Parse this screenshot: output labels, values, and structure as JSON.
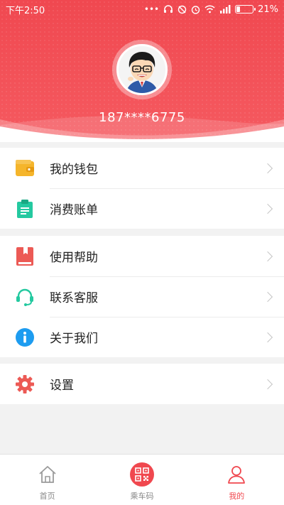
{
  "status": {
    "time": "下午2:50",
    "battery": "21%",
    "battery_level": 0.21,
    "icons": [
      "more-dots-icon",
      "headphones-icon",
      "no-notify-icon",
      "alarm-icon",
      "wifi-icon",
      "signal-icon",
      "battery-icon"
    ]
  },
  "profile": {
    "phone": "187****6775"
  },
  "menu_group1": [
    {
      "label": "我的钱包",
      "icon": "wallet-icon",
      "color": "#f5b52b"
    },
    {
      "label": "消费账单",
      "icon": "clipboard-icon",
      "color": "#24c9a0"
    }
  ],
  "menu_group2": [
    {
      "label": "使用帮助",
      "icon": "book-icon",
      "color": "#ec5a55"
    },
    {
      "label": "联系客服",
      "icon": "headset-icon",
      "color": "#24c9a0"
    },
    {
      "label": "关于我们",
      "icon": "info-icon",
      "color": "#1d9cf0"
    }
  ],
  "menu_group3": [
    {
      "label": "设置",
      "icon": "gear-icon",
      "color": "#ec5a55"
    }
  ],
  "nav": {
    "home": "首页",
    "ride_code": "乘车码",
    "mine": "我的"
  },
  "colors": {
    "brand": "#f0484f",
    "background": "#f2f2f2"
  }
}
